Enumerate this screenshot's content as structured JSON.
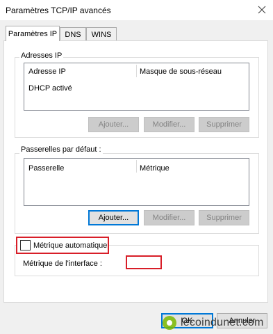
{
  "window": {
    "title": "Paramètres TCP/IP avancés"
  },
  "tabs": [
    {
      "label": "Paramètres IP",
      "active": true
    },
    {
      "label": "DNS",
      "active": false
    },
    {
      "label": "WINS",
      "active": false
    }
  ],
  "ip_group": {
    "legend": "Adresses IP",
    "columns": [
      "Adresse IP",
      "Masque de sous-réseau"
    ],
    "rows": [
      [
        "DHCP activé",
        ""
      ]
    ],
    "buttons": {
      "add": "Ajouter...",
      "modify": "Modifier...",
      "remove": "Supprimer"
    }
  },
  "gateway_group": {
    "legend": "Passerelles par défaut :",
    "columns": [
      "Passerelle",
      "Métrique"
    ],
    "buttons": {
      "add": "Ajouter...",
      "modify": "Modifier...",
      "remove": "Supprimer"
    }
  },
  "metric": {
    "auto_label": "Métrique automatique",
    "auto_checked": false,
    "interface_label": "Métrique de l'interface :",
    "interface_value": ""
  },
  "footer": {
    "ok": "OK",
    "cancel": "Annuler"
  },
  "watermark": {
    "text": "lecoindunet.com"
  },
  "colors": {
    "highlight_red": "#d81e28",
    "focus_blue": "#0078d7"
  }
}
